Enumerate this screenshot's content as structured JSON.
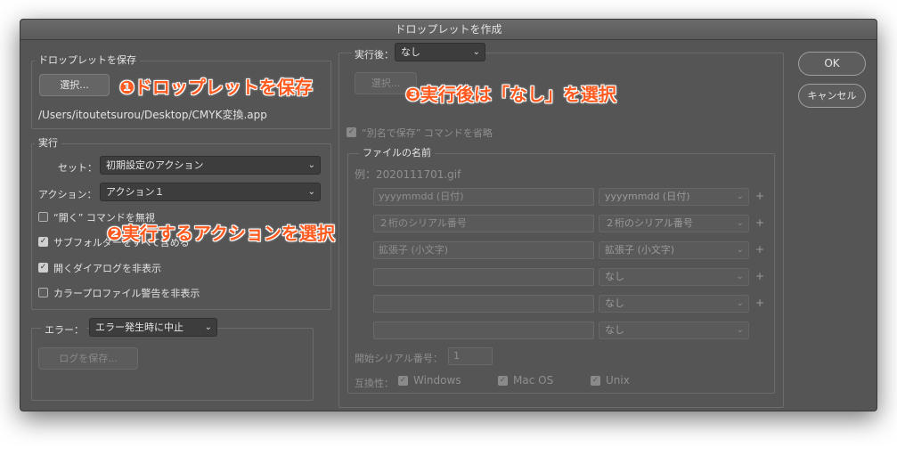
{
  "window": {
    "title": "ドロップレットを作成"
  },
  "save_group": {
    "legend": "ドロップレットを保存",
    "choose_label": "選択...",
    "path": "/Users/itoutetsurou/Desktop/CMYK変換.app"
  },
  "run_group": {
    "legend": "実行",
    "set_label": "セット：",
    "set_value": "初期設定のアクション",
    "action_label": "アクション：",
    "action_value": "アクション１",
    "options": [
      {
        "label": "“開く” コマンドを無視",
        "checked": false
      },
      {
        "label": "サブフォルダーをすべて含める",
        "checked": true
      },
      {
        "label": "開くダイアログを非表示",
        "checked": true
      },
      {
        "label": "カラープロファイル警告を非表示",
        "checked": false
      }
    ]
  },
  "error_group": {
    "label": "エラー：",
    "value": "エラー発生時に中止",
    "save_log_label": "ログを保存..."
  },
  "after_group": {
    "label": "実行後：",
    "value": "なし",
    "choose_label": "選択...",
    "override_save_as": {
      "label": "“別名で保存” コマンドを省略",
      "checked": true
    },
    "file_name": {
      "legend": "ファイルの名前",
      "example": "例：2020111701.gif",
      "rows": [
        {
          "input": "yyyymmdd (日付)",
          "select": "yyyymmdd (日付)",
          "plus": "+"
        },
        {
          "input": "２桁のシリアル番号",
          "select": "２桁のシリアル番号",
          "plus": "+"
        },
        {
          "input": "拡張子 (小文字)",
          "select": "拡張子 (小文字)",
          "plus": "+"
        },
        {
          "input": "",
          "select": "なし",
          "plus": "+"
        },
        {
          "input": "",
          "select": "なし",
          "plus": "+"
        },
        {
          "input": "",
          "select": "なし",
          "plus": ""
        }
      ],
      "serial_label": "開始シリアル番号：",
      "serial_value": "1",
      "compat_label": "互換性：",
      "compat": [
        {
          "label": "Windows",
          "checked": true
        },
        {
          "label": "Mac OS",
          "checked": true
        },
        {
          "label": "Unix",
          "checked": true
        }
      ]
    }
  },
  "buttons": {
    "ok": "OK",
    "cancel": "キャンセル"
  },
  "annotations": {
    "a1": "❶ドロップレットを保存",
    "a2": "❷実行するアクションを選択",
    "a3": "❸実行後は「なし」を選択"
  },
  "icons": {
    "chevron": "⌄",
    "check": "✓"
  },
  "colors": {
    "annotation": "#ff5a1f",
    "panel": "#555555"
  }
}
